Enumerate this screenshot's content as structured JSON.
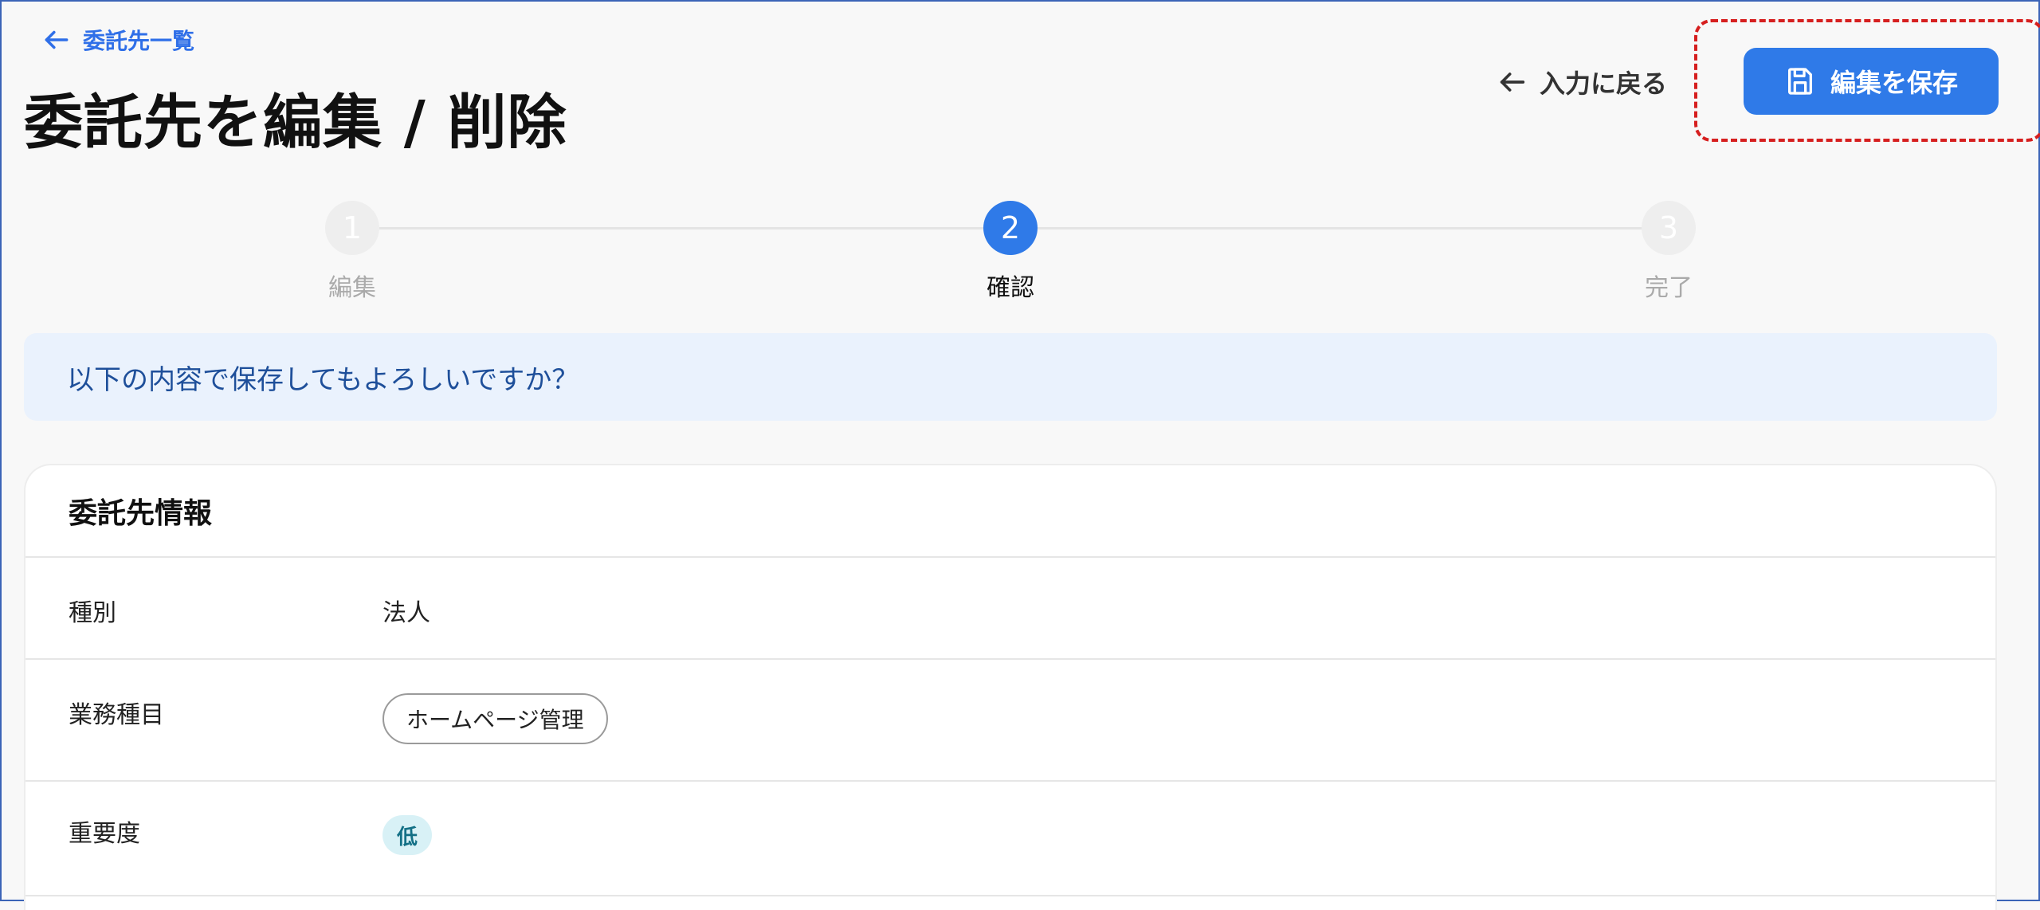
{
  "header": {
    "back_link_label": "委託先一覧",
    "title": "委託先を編集 / 削除",
    "back_to_input_label": "入力に戻る",
    "save_label": "編集を保存"
  },
  "stepper": {
    "steps": [
      {
        "number": "1",
        "label": "編集",
        "state": "inactive"
      },
      {
        "number": "2",
        "label": "確認",
        "state": "active"
      },
      {
        "number": "3",
        "label": "完了",
        "state": "inactive"
      }
    ]
  },
  "confirm_message": "以下の内容で保存してもよろしいですか？",
  "card": {
    "title": "委託先情報",
    "rows": [
      {
        "label": "種別",
        "value": "法人"
      },
      {
        "label": "業務種目",
        "value": "ホームページ管理"
      },
      {
        "label": "重要度",
        "value": "低"
      }
    ]
  },
  "colors": {
    "accent": "#2f7ae8",
    "highlight_border": "#d61f1f",
    "banner_bg": "#eaf2fd",
    "badge_bg": "#d8f1f6"
  },
  "icons": {
    "back": "arrow-left-icon",
    "save": "floppy-disk-icon"
  }
}
